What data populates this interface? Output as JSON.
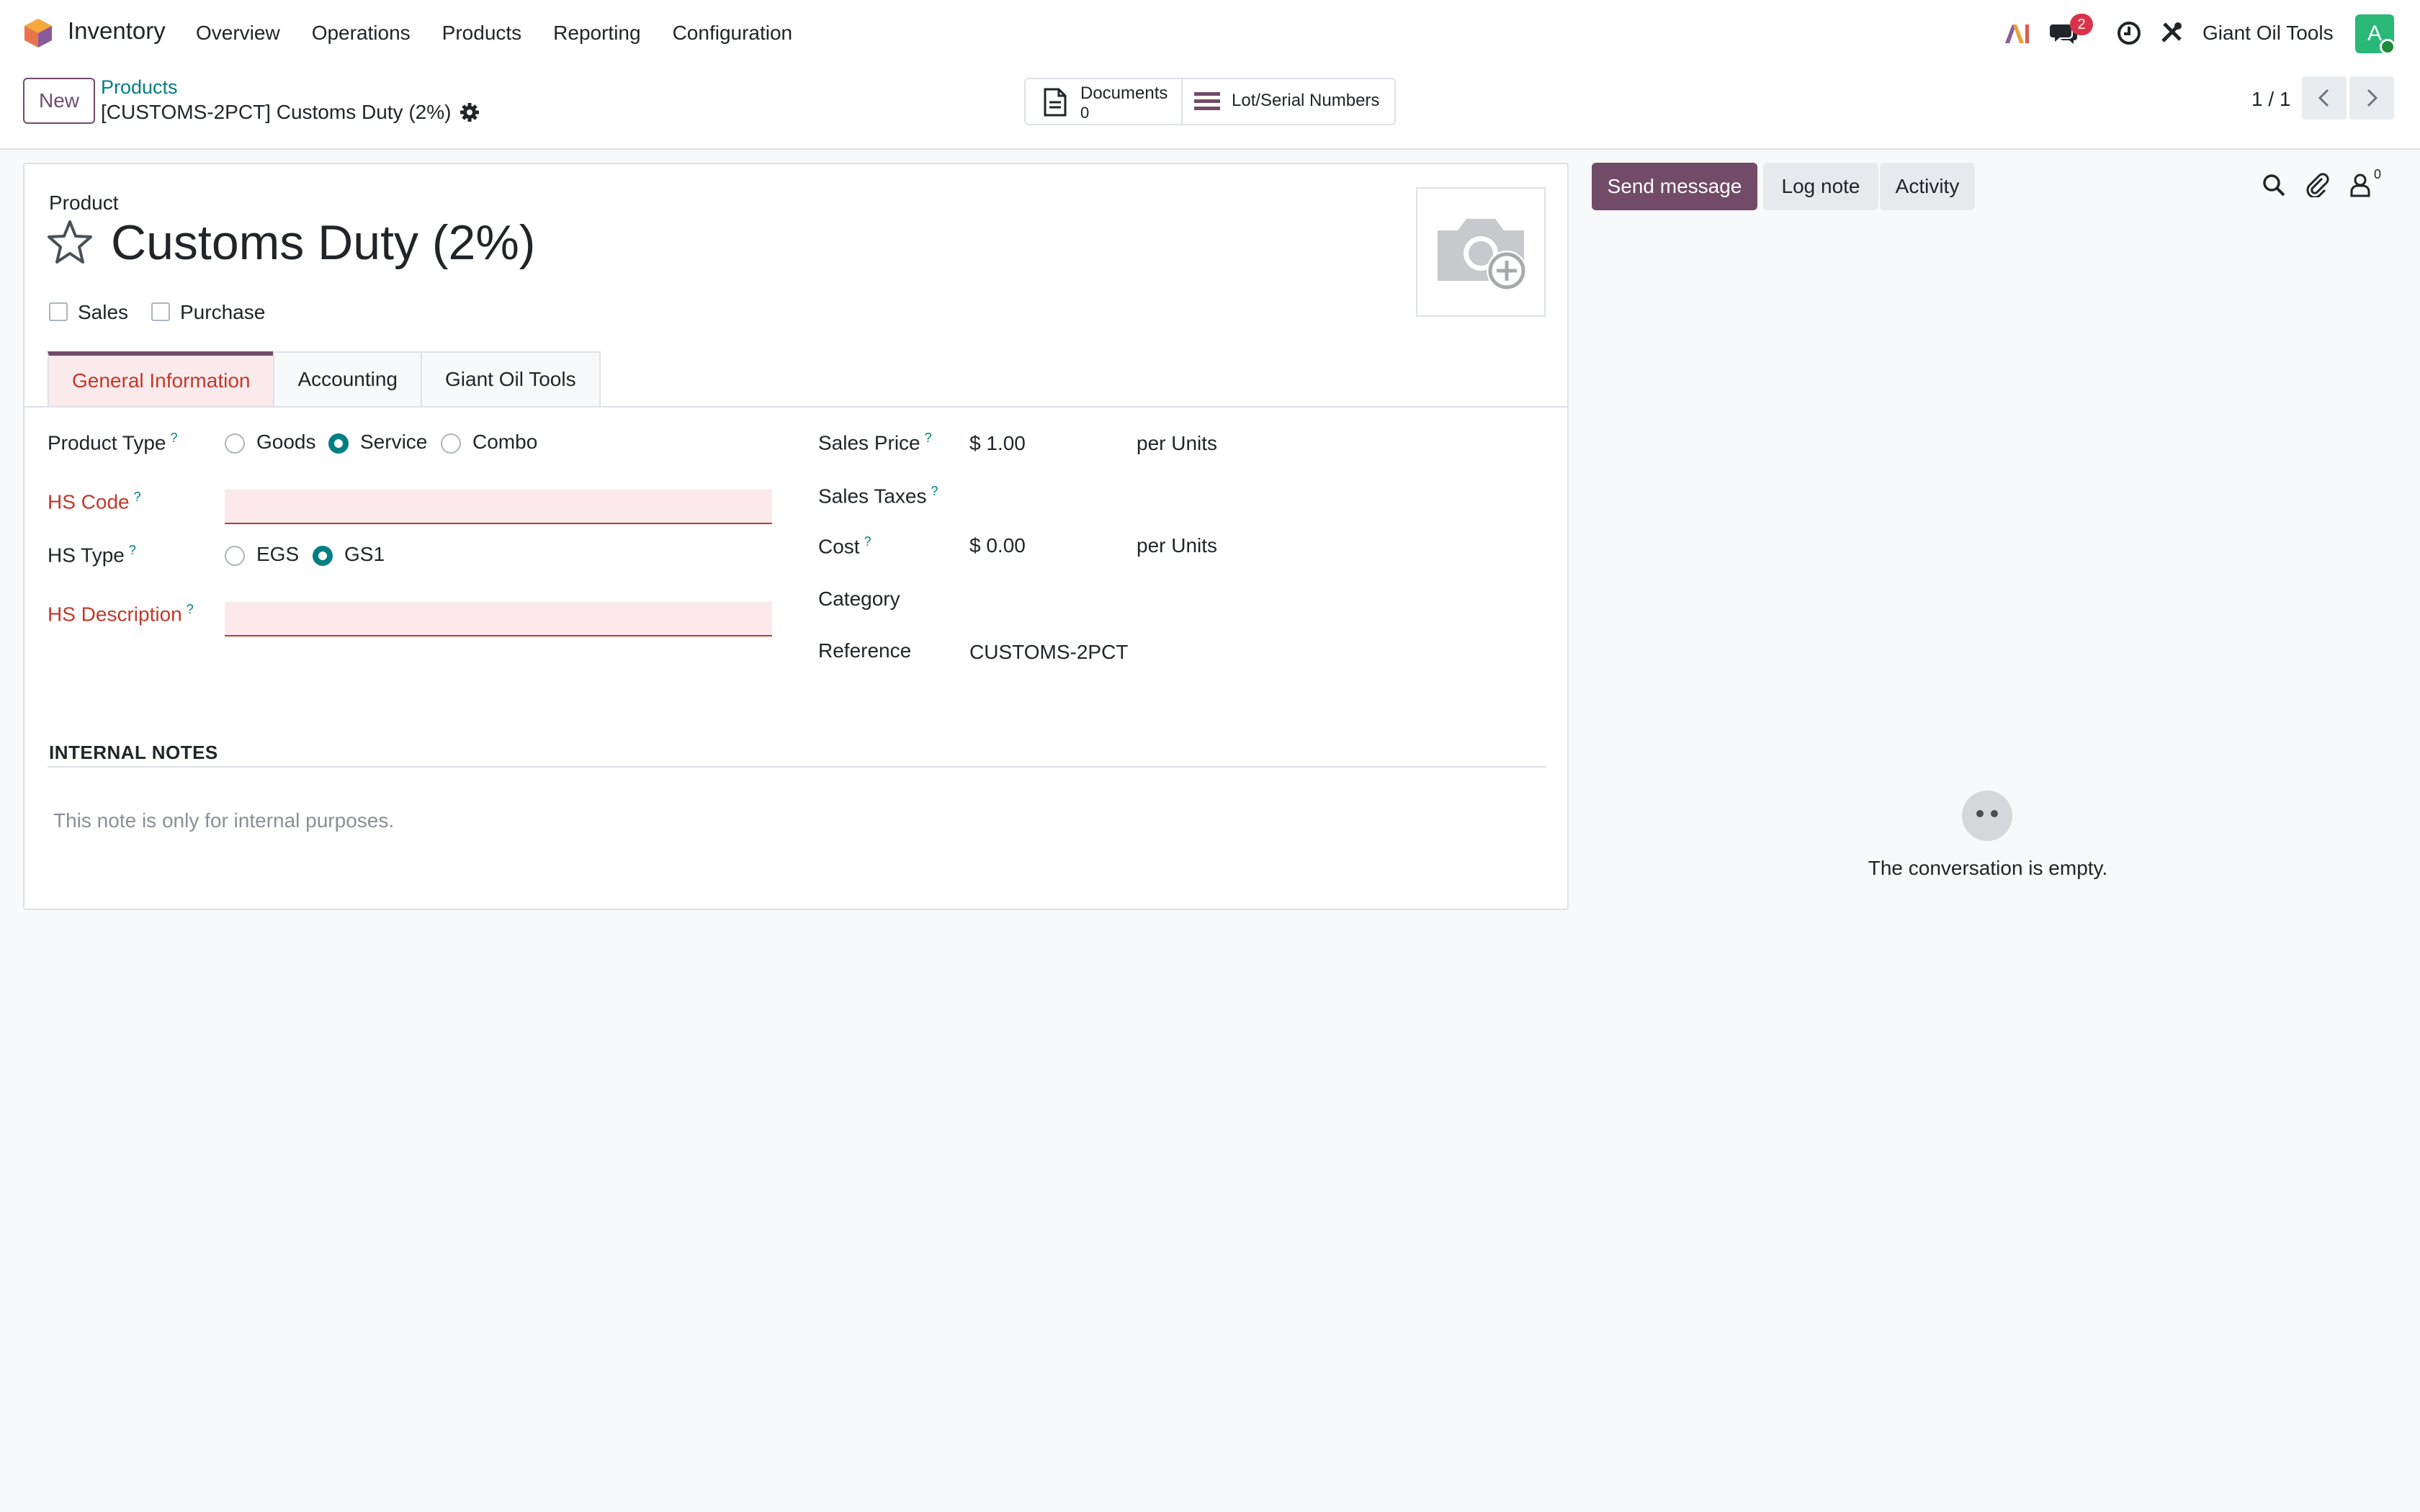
{
  "navbar": {
    "app_name": "Inventory",
    "menu": [
      "Overview",
      "Operations",
      "Products",
      "Reporting",
      "Configuration"
    ],
    "messages_badge": "2",
    "company": "Giant Oil Tools",
    "avatar_initial": "A"
  },
  "control_panel": {
    "new_label": "New",
    "breadcrumb": "Products",
    "record_title": "[CUSTOMS-2PCT] Customs Duty (2%)",
    "smart_buttons": {
      "documents_label": "Documents",
      "documents_count": "0",
      "lots_label": "Lot/Serial Numbers"
    },
    "pager": "1 / 1"
  },
  "form": {
    "product_label": "Product",
    "product_name": "Customs Duty (2%)",
    "checkboxes": {
      "sales": "Sales",
      "purchase": "Purchase"
    },
    "tabs": [
      "General Information",
      "Accounting",
      "Giant Oil Tools"
    ],
    "left": {
      "product_type_label": "Product Type",
      "product_type_options": [
        "Goods",
        "Service",
        "Combo"
      ],
      "product_type_selected": "Service",
      "hs_code_label": "HS Code",
      "hs_type_label": "HS Type",
      "hs_type_options": [
        "EGS",
        "GS1"
      ],
      "hs_type_selected": "GS1",
      "hs_description_label": "HS Description"
    },
    "right": {
      "sales_price_label": "Sales Price",
      "sales_price_value": "$ 1.00",
      "sales_price_unit": "per Units",
      "sales_taxes_label": "Sales Taxes",
      "cost_label": "Cost",
      "cost_value": "$ 0.00",
      "cost_unit": "per Units",
      "category_label": "Category",
      "reference_label": "Reference",
      "reference_value": "CUSTOMS-2PCT"
    },
    "help_mark": "?",
    "notes_title": "INTERNAL NOTES",
    "notes_placeholder": "This note is only for internal purposes."
  },
  "chatter": {
    "send_message": "Send message",
    "log_note": "Log note",
    "activity": "Activity",
    "followers_count": "0",
    "empty_text": "The conversation is empty."
  },
  "colors": {
    "brand": "#714b67",
    "accent": "#017e84",
    "required": "#c0392b",
    "badge": "#d9334b"
  }
}
